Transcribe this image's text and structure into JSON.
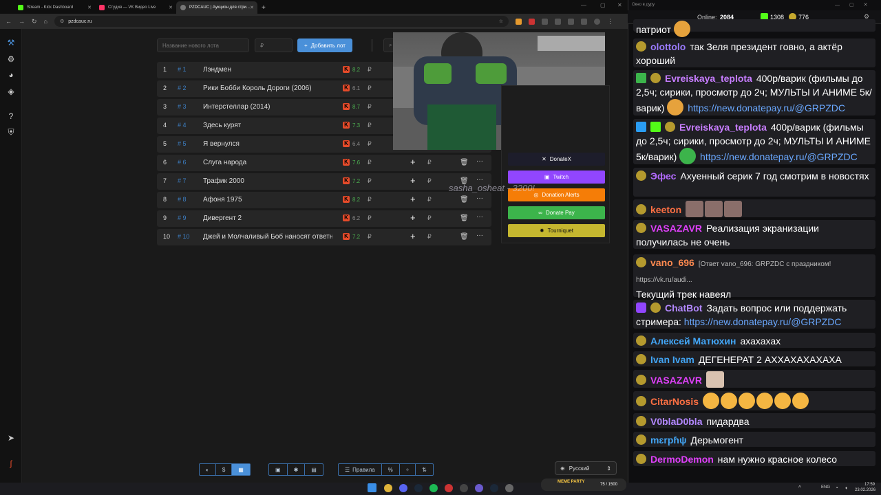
{
  "browser": {
    "tabs": [
      {
        "label": "Stream - Kick Dashboard",
        "color": "#53fc18"
      },
      {
        "label": "Студия — VK Видео Live",
        "color": "#ff3366"
      },
      {
        "label": "PZDCAUC | Аукцион для стри...",
        "color": "#888888",
        "active": true
      }
    ],
    "new_tab": "+",
    "url": "pzdcauc.ru",
    "win_controls": [
      "—",
      "▢",
      "✕"
    ]
  },
  "toolbar": {
    "lot_placeholder": "Название нового лота",
    "amount_placeholder": "₽",
    "add_label": "Добавить лот"
  },
  "lots": [
    {
      "n": "1",
      "id": "# 1",
      "title": "Лэндмен",
      "rating": "8.2",
      "rating_color": "#4caf50",
      "cur": "₽"
    },
    {
      "n": "2",
      "id": "# 2",
      "title": "Рики Бобби Король Дороги (2006)",
      "rating": "6.1",
      "rating_color": "#888888",
      "cur": "₽"
    },
    {
      "n": "3",
      "id": "# 3",
      "title": "Интерстеллар (2014)",
      "rating": "8.7",
      "rating_color": "#4caf50",
      "cur": "₽"
    },
    {
      "n": "4",
      "id": "# 4",
      "title": "Здесь курят",
      "rating": "7.3",
      "rating_color": "#4caf50",
      "cur": "₽"
    },
    {
      "n": "5",
      "id": "# 5",
      "title": "Я вернулся",
      "rating": "6.4",
      "rating_color": "#888888",
      "cur": "₽"
    },
    {
      "n": "6",
      "id": "# 6",
      "title": "Слуга народа",
      "rating": "7.6",
      "rating_color": "#4caf50",
      "cur": "₽"
    },
    {
      "n": "7",
      "id": "# 7",
      "title": "Трафик 2000",
      "rating": "7.2",
      "rating_color": "#4caf50",
      "cur": "₽"
    },
    {
      "n": "8",
      "id": "# 8",
      "title": "Афоня 1975",
      "rating": "8.2",
      "rating_color": "#4caf50",
      "cur": "₽"
    },
    {
      "n": "9",
      "id": "# 9",
      "title": "Дивергент 2",
      "rating": "6.2",
      "rating_color": "#888888",
      "cur": "₽"
    },
    {
      "n": "10",
      "id": "# 10",
      "title": "Джей и Молчаливый Боб наносят ответный удар",
      "rating": "7.2",
      "rating_color": "#4caf50",
      "cur": "₽"
    }
  ],
  "donations": [
    {
      "label": "DonateX",
      "color": "#1d1d2b",
      "icon": "✕"
    },
    {
      "label": "Twitch",
      "color": "#9146ff",
      "icon": "▣"
    },
    {
      "label": "Donation Alerts",
      "color": "#f57d07",
      "icon": "◎"
    },
    {
      "label": "Donate Pay",
      "color": "#3cb44b",
      "icon": "∞"
    },
    {
      "label": "Tourniquet",
      "color": "#c5b72f",
      "icon": "✹"
    }
  ],
  "overlay_text": "sasha_osheat - 3200!",
  "bottom_toolbar": {
    "rules": "Правила",
    "language": "Русский"
  },
  "chat": {
    "window_title": "Окно в дуру",
    "online_label": "Online:",
    "online": "2084",
    "kick_count": "1308",
    "second_count": "776",
    "messages": [
      {
        "nick": "",
        "color": "#ffffff",
        "text": "патриот"
      },
      {
        "nick": "olottolo",
        "color": "#9b7bff",
        "text": "так Зеля президент говно, а актёр хороший"
      },
      {
        "nick": "Evreiskaya_teplota",
        "color": "#c77dff",
        "text": "400р/варик (фильмы до 2,5ч; сирики, просмотр до 2ч; МУЛЬТЫ И АНИМЕ 5к/варик)",
        "link": "https://new.donatepay.ru/@GRPZDC"
      },
      {
        "nick": "Evreiskaya_teplota",
        "color": "#c77dff",
        "text": "400р/варик (фильмы до 2,5ч; сирики, просмотр до 2ч; МУЛЬТЫ И АНИМЕ 5к/варик)",
        "link": "https://new.donatepay.ru/@GRPZDC"
      },
      {
        "nick": "Эфес",
        "color": "#b36bff",
        "text": "Ахуенный серик 7 год смотрим в новостях"
      },
      {
        "nick": "keeton",
        "color": "#ff7043",
        "text": ""
      },
      {
        "nick": "VASAZAVR",
        "color": "#e040fb",
        "text": "Реализация экранизации получилась не очень"
      },
      {
        "nick": "vano_696",
        "color": "#ff8a50",
        "reply": "[Ответ vano_696: GRPZDC с праздником!",
        "reply_link": "https://vk.ru/audi...",
        "text": "Текущий трек навеял"
      },
      {
        "nick": "ChatBot",
        "color": "#b388ff",
        "text": "Задать вопрос или поддержать стримера:",
        "link": "https://new.donatepay.ru/@GRPZDC"
      },
      {
        "nick": "Алексей Матюхин",
        "color": "#42a5f5",
        "text": "ахахахах"
      },
      {
        "nick": "Ivan Ivam",
        "color": "#42a5f5",
        "text": "ДЕГЕНЕРАТ 2 АХХАХАХАХАХА"
      },
      {
        "nick": "VASAZAVR",
        "color": "#e040fb",
        "text": ""
      },
      {
        "nick": "CitarNosis",
        "color": "#ff7043",
        "text": ""
      },
      {
        "nick": "V0blaD0bla",
        "color": "#b388ff",
        "text": "пидардва"
      },
      {
        "nick": "mɛrpɦψ",
        "color": "#42a5f5",
        "text": "Дерьмогент"
      },
      {
        "nick": "DermoDemon",
        "color": "#e040fb",
        "text": "нам нужно красное колесо"
      }
    ]
  },
  "taskbar": {
    "media_label": "MEME PARTY",
    "counter": "75 / 1500",
    "lang": "ENG",
    "time": "17:59",
    "date": "23.02.2026"
  }
}
